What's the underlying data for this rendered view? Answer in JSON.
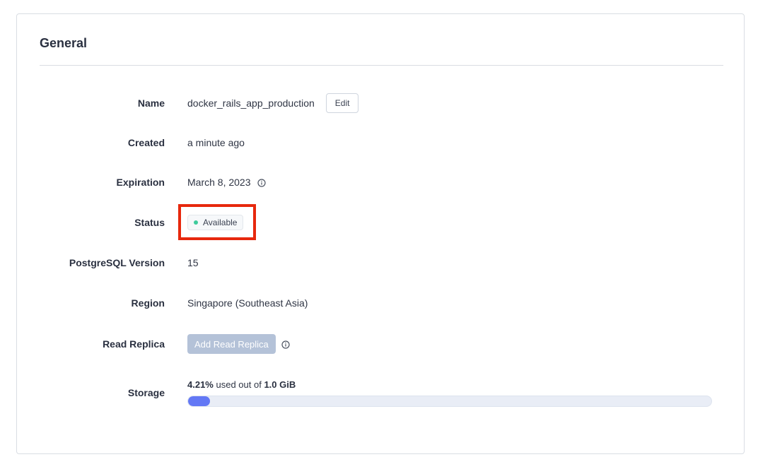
{
  "card": {
    "title": "General"
  },
  "fields": {
    "name": {
      "label": "Name",
      "value": "docker_rails_app_production",
      "edit_label": "Edit"
    },
    "created": {
      "label": "Created",
      "value": "a minute ago"
    },
    "expiration": {
      "label": "Expiration",
      "value": "March 8, 2023",
      "icon": "info-icon"
    },
    "status": {
      "label": "Status",
      "value": "Available",
      "dot_color": "#3ecb9c"
    },
    "postgres_version": {
      "label": "PostgreSQL Version",
      "value": "15"
    },
    "region": {
      "label": "Region",
      "value": "Singapore (Southeast Asia)"
    },
    "read_replica": {
      "label": "Read Replica",
      "button_label": "Add Read Replica",
      "icon": "info-icon"
    },
    "storage": {
      "label": "Storage",
      "percent_text": "4.21%",
      "middle_text": " used out of ",
      "total_text": "1.0 GiB",
      "used_fraction": 0.0421
    }
  },
  "colors": {
    "highlight_border": "#e7280d",
    "progress_fill": "#6378f5",
    "disabled_button": "#b4c2d8"
  }
}
